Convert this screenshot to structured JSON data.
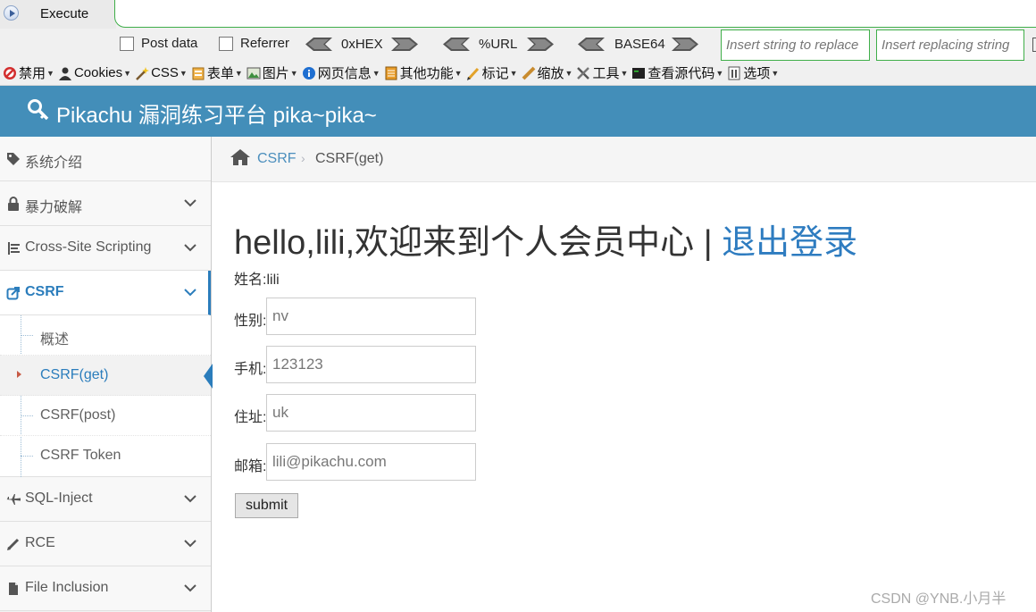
{
  "hackbar": {
    "execute_label": "Execute",
    "post_data_label": "Post data",
    "referrer_label": "Referrer",
    "hex_label": "0xHEX",
    "url_label": "%URL",
    "base64_label": "BASE64",
    "find_placeholder": "Insert string to replace",
    "replace_placeholder": "Insert replacing string"
  },
  "devbar": {
    "items": [
      {
        "label": "禁用",
        "icon": "disable-icon"
      },
      {
        "label": "Cookies",
        "icon": "cookie-icon"
      },
      {
        "label": "CSS",
        "icon": "css-wand-icon"
      },
      {
        "label": "表单",
        "icon": "form-icon"
      },
      {
        "label": "图片",
        "icon": "image-icon"
      },
      {
        "label": "网页信息",
        "icon": "info-icon"
      },
      {
        "label": "其他功能",
        "icon": "misc-icon"
      },
      {
        "label": "标记",
        "icon": "pencil-icon"
      },
      {
        "label": "缩放",
        "icon": "ruler-icon"
      },
      {
        "label": "工具",
        "icon": "tools-icon"
      },
      {
        "label": "查看源代码",
        "icon": "terminal-icon"
      },
      {
        "label": "选项",
        "icon": "options-icon"
      }
    ]
  },
  "site": {
    "title": "Pikachu 漏洞练习平台 pika~pika~",
    "header_color": "#438eb9"
  },
  "sidebar": {
    "items": [
      {
        "label": "系统介绍",
        "icon": "tags-icon"
      },
      {
        "label": "暴力破解",
        "icon": "lock-icon"
      },
      {
        "label": "Cross-Site Scripting",
        "icon": "list-tree-icon"
      },
      {
        "label": "CSRF",
        "icon": "external-link-icon"
      },
      {
        "label": "SQL-Inject",
        "icon": "plane-icon"
      },
      {
        "label": "RCE",
        "icon": "pencil-icon"
      },
      {
        "label": "File Inclusion",
        "icon": "file-icon"
      }
    ],
    "csrf_sub": [
      "概述",
      "CSRF(get)",
      "CSRF(post)",
      "CSRF Token"
    ]
  },
  "breadcrumb": {
    "parent": "CSRF",
    "separator": "›",
    "current": "CSRF(get)"
  },
  "main": {
    "greeting": "hello,lili,欢迎来到个人会员中心 | ",
    "logout": "退出登录",
    "name_label": "姓名:",
    "name_value": "lili",
    "sex_label": "性别:",
    "sex_value": "nv",
    "phone_label": "手机:",
    "phone_value": "123123",
    "addr_label": "住址:",
    "addr_value": "uk",
    "email_label": "邮箱:",
    "email_value": "lili@pikachu.com",
    "submit_label": "submit"
  },
  "watermark": "CSDN @YNB.小月半",
  "colors": {
    "accent": "#2b7dbc",
    "link": "#4c8fbd",
    "hackbar_border": "#3fae49"
  }
}
